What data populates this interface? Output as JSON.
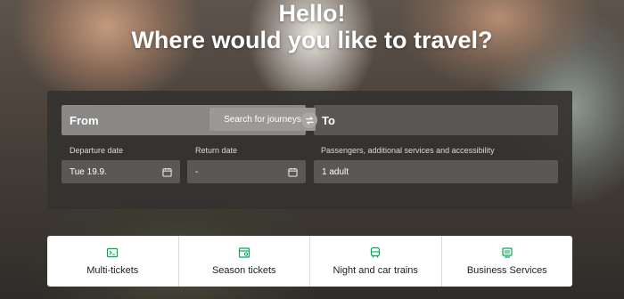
{
  "hero": {
    "greeting": "Hello!",
    "question": "Where would you like to travel?"
  },
  "search": {
    "from_label": "From",
    "to_label": "To",
    "departure_label": "Departure date",
    "departure_value": "Tue 19.9.",
    "return_label": "Return date",
    "return_value": "-",
    "passengers_label": "Passengers, additional services and accessibility",
    "passengers_value": "1 adult",
    "search_button": "Search for journeys"
  },
  "quick_links": [
    {
      "label": "Multi-tickets",
      "icon": "multi-ticket-icon"
    },
    {
      "label": "Season tickets",
      "icon": "season-ticket-icon"
    },
    {
      "label": "Night and car trains",
      "icon": "train-icon"
    },
    {
      "label": "Business Services",
      "icon": "business-icon"
    }
  ],
  "colors": {
    "accent_green": "#00a651"
  }
}
